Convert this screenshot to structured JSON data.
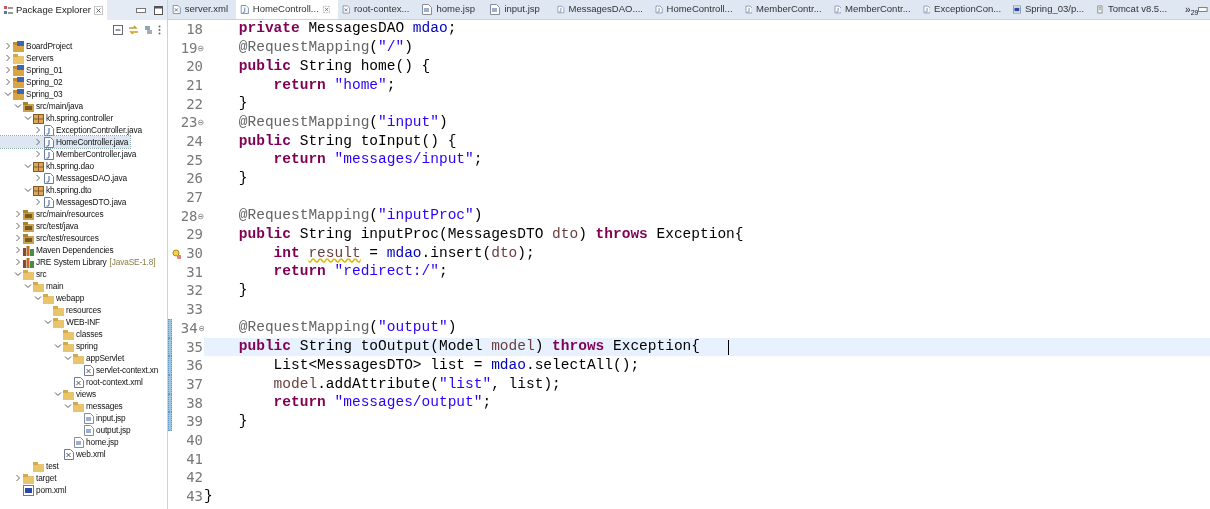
{
  "explorer": {
    "title": "Package Explorer",
    "tree": [
      {
        "label": "BoardProject",
        "kind": "project",
        "expanded": false,
        "selected": false
      },
      {
        "label": "Servers",
        "kind": "folder",
        "expanded": false,
        "selected": false
      },
      {
        "label": "Spring_01",
        "kind": "project",
        "expanded": false,
        "selected": false
      },
      {
        "label": "Spring_02",
        "kind": "project",
        "expanded": false,
        "selected": false
      },
      {
        "label": "Spring_03",
        "kind": "project",
        "expanded": true,
        "selected": false,
        "children": [
          {
            "label": "src/main/java",
            "kind": "source",
            "expanded": true,
            "selected": false,
            "children": [
              {
                "label": "kh.spring.controller",
                "kind": "package",
                "expanded": true,
                "selected": false,
                "children": [
                  {
                    "label": "ExceptionController.java",
                    "kind": "java",
                    "expanded": false,
                    "selected": false
                  },
                  {
                    "label": "HomeController.java",
                    "kind": "java",
                    "expanded": false,
                    "selected": true
                  },
                  {
                    "label": "MemberController.java",
                    "kind": "java",
                    "expanded": false,
                    "selected": false
                  }
                ]
              },
              {
                "label": "kh.spring.dao",
                "kind": "package",
                "expanded": true,
                "selected": false,
                "children": [
                  {
                    "label": "MessagesDAO.java",
                    "kind": "java",
                    "expanded": false,
                    "selected": false
                  }
                ]
              },
              {
                "label": "kh.spring.dto",
                "kind": "package",
                "expanded": true,
                "selected": false,
                "children": [
                  {
                    "label": "MessagesDTO.java",
                    "kind": "java",
                    "expanded": false,
                    "selected": false
                  }
                ]
              }
            ]
          },
          {
            "label": "src/main/resources",
            "kind": "source",
            "expanded": false,
            "selected": false
          },
          {
            "label": "src/test/java",
            "kind": "source",
            "expanded": false,
            "selected": false
          },
          {
            "label": "src/test/resources",
            "kind": "source",
            "expanded": false,
            "selected": false
          },
          {
            "label": "Maven Dependencies",
            "kind": "library",
            "expanded": false,
            "selected": false
          },
          {
            "label": "JRE System Library",
            "decoration": "[JavaSE-1.8]",
            "kind": "library",
            "expanded": false,
            "selected": false
          },
          {
            "label": "src",
            "kind": "folder",
            "expanded": true,
            "selected": false,
            "children": [
              {
                "label": "main",
                "kind": "folder",
                "expanded": true,
                "selected": false,
                "children": [
                  {
                    "label": "webapp",
                    "kind": "folder",
                    "expanded": true,
                    "selected": false,
                    "children": [
                      {
                        "label": "resources",
                        "kind": "folder",
                        "selected": false
                      },
                      {
                        "label": "WEB-INF",
                        "kind": "folder",
                        "expanded": true,
                        "selected": false,
                        "children": [
                          {
                            "label": "classes",
                            "kind": "folder",
                            "selected": false
                          },
                          {
                            "label": "spring",
                            "kind": "folder",
                            "expanded": true,
                            "selected": false,
                            "children": [
                              {
                                "label": "appServlet",
                                "kind": "folder",
                                "expanded": true,
                                "selected": false,
                                "children": [
                                  {
                                    "label": "servlet-context.xn",
                                    "kind": "xml",
                                    "selected": false
                                  }
                                ]
                              },
                              {
                                "label": "root-context.xml",
                                "kind": "xml",
                                "selected": false
                              }
                            ]
                          },
                          {
                            "label": "views",
                            "kind": "folder",
                            "expanded": true,
                            "selected": false,
                            "children": [
                              {
                                "label": "messages",
                                "kind": "folder",
                                "expanded": true,
                                "selected": false,
                                "children": [
                                  {
                                    "label": "input.jsp",
                                    "kind": "jsp",
                                    "selected": false
                                  },
                                  {
                                    "label": "output.jsp",
                                    "kind": "jsp",
                                    "selected": false
                                  }
                                ]
                              },
                              {
                                "label": "home.jsp",
                                "kind": "jsp",
                                "selected": false
                              }
                            ]
                          },
                          {
                            "label": "web.xml",
                            "kind": "xml",
                            "selected": false
                          }
                        ]
                      }
                    ]
                  }
                ]
              },
              {
                "label": "test",
                "kind": "folder",
                "selected": false
              }
            ]
          },
          {
            "label": "target",
            "kind": "folder",
            "expanded": false,
            "selected": false
          },
          {
            "label": "pom.xml",
            "kind": "pom",
            "selected": false
          }
        ]
      }
    ]
  },
  "tabs": [
    {
      "label": "server.xml",
      "kind": "xml",
      "selected": false
    },
    {
      "label": "HomeControll...",
      "kind": "java",
      "selected": true
    },
    {
      "label": "root-contex...",
      "kind": "xml",
      "selected": false
    },
    {
      "label": "home.jsp",
      "kind": "jsp",
      "selected": false
    },
    {
      "label": "input.jsp",
      "kind": "jsp",
      "selected": false
    },
    {
      "label": "MessagesDAO....",
      "kind": "java",
      "selected": false
    },
    {
      "label": "HomeControll...",
      "kind": "java",
      "selected": false
    },
    {
      "label": "MemberContr...",
      "kind": "java",
      "selected": false
    },
    {
      "label": "MemberContr...",
      "kind": "java",
      "selected": false
    },
    {
      "label": "ExceptionCon...",
      "kind": "java",
      "selected": false
    },
    {
      "label": "Spring_03/p...",
      "kind": "pom",
      "selected": false
    },
    {
      "label": "Tomcat v8.5...",
      "kind": "server",
      "selected": false
    }
  ],
  "tab_overflow": {
    "symbol": "»",
    "count": "29"
  },
  "code": [
    {
      "number": "18",
      "segments": [
        {
          "text": "    private ",
          "kind": "keyword"
        },
        {
          "text": "MessagesDAO ",
          "kind": "plain"
        },
        {
          "text": "mdao",
          "kind": "field"
        },
        {
          "text": ";",
          "kind": "plain"
        }
      ]
    },
    {
      "number": "19",
      "fold": true,
      "segments": [
        {
          "text": "    @RequestMapping",
          "kind": "annotation"
        },
        {
          "text": "(",
          "kind": "plain"
        },
        {
          "text": "\"/\"",
          "kind": "string"
        },
        {
          "text": ")",
          "kind": "plain"
        }
      ]
    },
    {
      "number": "20",
      "segments": [
        {
          "text": "    public",
          "kind": "keyword"
        },
        {
          "text": " String home() {",
          "kind": "plain"
        }
      ]
    },
    {
      "number": "21",
      "segments": [
        {
          "text": "        return ",
          "kind": "keyword"
        },
        {
          "text": "\"home\"",
          "kind": "string"
        },
        {
          "text": ";",
          "kind": "plain"
        }
      ]
    },
    {
      "number": "22",
      "segments": [
        {
          "text": "    }",
          "kind": "plain"
        }
      ]
    },
    {
      "number": "23",
      "fold": true,
      "segments": [
        {
          "text": "    @RequestMapping",
          "kind": "annotation"
        },
        {
          "text": "(",
          "kind": "plain"
        },
        {
          "text": "\"input\"",
          "kind": "string"
        },
        {
          "text": ")",
          "kind": "plain"
        }
      ]
    },
    {
      "number": "24",
      "segments": [
        {
          "text": "    public",
          "kind": "keyword"
        },
        {
          "text": " String toInput() {",
          "kind": "plain"
        }
      ]
    },
    {
      "number": "25",
      "segments": [
        {
          "text": "        return ",
          "kind": "keyword"
        },
        {
          "text": "\"messages/input\"",
          "kind": "string"
        },
        {
          "text": ";",
          "kind": "plain"
        }
      ]
    },
    {
      "number": "26",
      "segments": [
        {
          "text": "    }",
          "kind": "plain"
        }
      ]
    },
    {
      "number": "27"
    },
    {
      "number": "28",
      "fold": true,
      "segments": [
        {
          "text": "    @RequestMapping",
          "kind": "annotation"
        },
        {
          "text": "(",
          "kind": "plain"
        },
        {
          "text": "\"inputProc\"",
          "kind": "string"
        },
        {
          "text": ")",
          "kind": "plain"
        }
      ]
    },
    {
      "number": "29",
      "segments": [
        {
          "text": "    public",
          "kind": "keyword"
        },
        {
          "text": " String inputProc(MessagesDTO ",
          "kind": "plain"
        },
        {
          "text": "dto",
          "kind": "parameter"
        },
        {
          "text": ") ",
          "kind": "plain"
        },
        {
          "text": "throws",
          "kind": "keyword"
        },
        {
          "text": " Exception{",
          "kind": "plain"
        }
      ]
    },
    {
      "number": "30",
      "warning": true,
      "segments": [
        {
          "text": "        int ",
          "kind": "keyword"
        },
        {
          "text": "result",
          "kind": "warning"
        },
        {
          "text": " = ",
          "kind": "plain"
        },
        {
          "text": "mdao",
          "kind": "field"
        },
        {
          "text": ".insert(",
          "kind": "plain"
        },
        {
          "text": "dto",
          "kind": "parameter"
        },
        {
          "text": ");",
          "kind": "plain"
        }
      ]
    },
    {
      "number": "31",
      "segments": [
        {
          "text": "        return ",
          "kind": "keyword"
        },
        {
          "text": "\"redirect:/\"",
          "kind": "string"
        },
        {
          "text": ";",
          "kind": "plain"
        }
      ]
    },
    {
      "number": "32",
      "segments": [
        {
          "text": "    }",
          "kind": "plain"
        }
      ]
    },
    {
      "number": "33"
    },
    {
      "number": "34",
      "fold": true,
      "changed": true,
      "segments": [
        {
          "text": "    @RequestMapping",
          "kind": "annotation"
        },
        {
          "text": "(",
          "kind": "plain"
        },
        {
          "text": "\"output\"",
          "kind": "string"
        },
        {
          "text": ")",
          "kind": "plain"
        }
      ]
    },
    {
      "number": "35",
      "changed": true,
      "current": true,
      "segments": [
        {
          "text": "    public",
          "kind": "keyword"
        },
        {
          "text": " String toOutput(Model ",
          "kind": "plain"
        },
        {
          "text": "model",
          "kind": "parameter"
        },
        {
          "text": ") ",
          "kind": "plain"
        },
        {
          "text": "throws",
          "kind": "keyword"
        },
        {
          "text": " Exception{",
          "kind": "plain"
        }
      ]
    },
    {
      "number": "36",
      "changed": true,
      "segments": [
        {
          "text": "        List<MessagesDTO> list = ",
          "kind": "plain"
        },
        {
          "text": "mdao",
          "kind": "field"
        },
        {
          "text": ".selectAll();",
          "kind": "plain"
        }
      ]
    },
    {
      "number": "37",
      "changed": true,
      "segments": [
        {
          "text": "        model",
          "kind": "parameter"
        },
        {
          "text": ".addAttribute(",
          "kind": "plain"
        },
        {
          "text": "\"list\"",
          "kind": "string"
        },
        {
          "text": ", list);",
          "kind": "plain"
        }
      ]
    },
    {
      "number": "38",
      "changed": true,
      "segments": [
        {
          "text": "        return ",
          "kind": "keyword"
        },
        {
          "text": "\"messages/output\"",
          "kind": "string"
        },
        {
          "text": ";",
          "kind": "plain"
        }
      ]
    },
    {
      "number": "39",
      "changed": true,
      "segments": [
        {
          "text": "    }",
          "kind": "plain"
        }
      ]
    },
    {
      "number": "40"
    },
    {
      "number": "41"
    },
    {
      "number": "42"
    },
    {
      "number": "43",
      "segments": [
        {
          "text": "}",
          "kind": "plain"
        }
      ]
    }
  ]
}
